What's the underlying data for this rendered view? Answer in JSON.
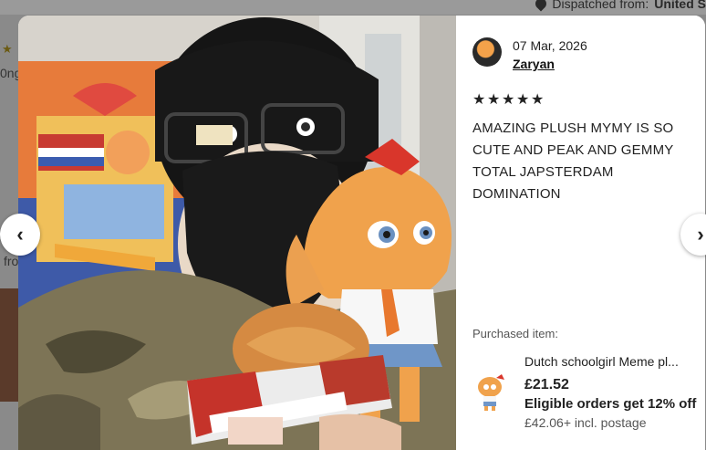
{
  "background": {
    "dispatch_prefix": "Dispatched from:",
    "dispatch_location": "United S",
    "fragment_1": "0ng",
    "fragment_2": "fro"
  },
  "review": {
    "date": "07 Mar, 2026",
    "author": "Zaryan",
    "rating": 5,
    "text": "AMAZING PLUSH MYMY IS SO CUTE AND PEAK AND GEMMY TOTAL JAPSTERDAM DOMINATION"
  },
  "purchased": {
    "label": "Purchased item:",
    "title": "Dutch schoolgirl Meme pl...",
    "price": "£21.52",
    "promo": "Eligible orders get 12% off",
    "shipping": "£42.06+ incl. postage"
  },
  "icons": {
    "prev": "chevron-left-icon",
    "next": "chevron-right-icon",
    "star": "star-icon",
    "location": "location-pin-icon"
  }
}
